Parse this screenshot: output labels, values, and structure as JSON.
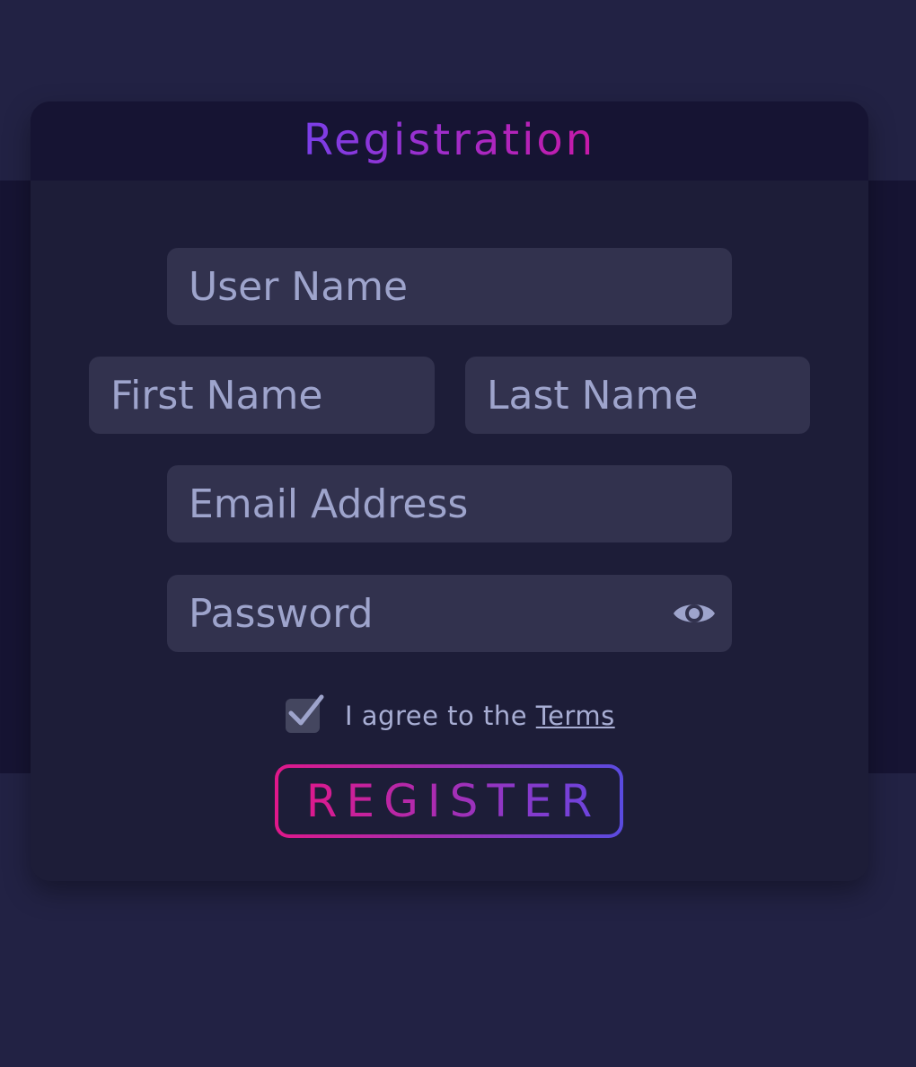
{
  "form": {
    "title": "Registration",
    "username_placeholder": "User Name",
    "firstname_placeholder": "First Name",
    "lastname_placeholder": "Last Name",
    "email_placeholder": "Email Address",
    "password_placeholder": "Password",
    "agree_text": "I agree to the ",
    "terms_link": "Terms",
    "agree_checked": true,
    "register_label": "REGISTER"
  },
  "icons": {
    "password_toggle": "eye-icon",
    "checkbox_mark": "checkmark-icon"
  },
  "colors": {
    "page_background": "#222244",
    "band_background": "#161433",
    "card_background": "#1d1d38",
    "field_background": "#32324e",
    "placeholder_text": "#9ea4cc",
    "gradient_pink": "#e0188a",
    "gradient_purple": "#7a3fe8",
    "gradient_blue": "#5a4be0"
  }
}
